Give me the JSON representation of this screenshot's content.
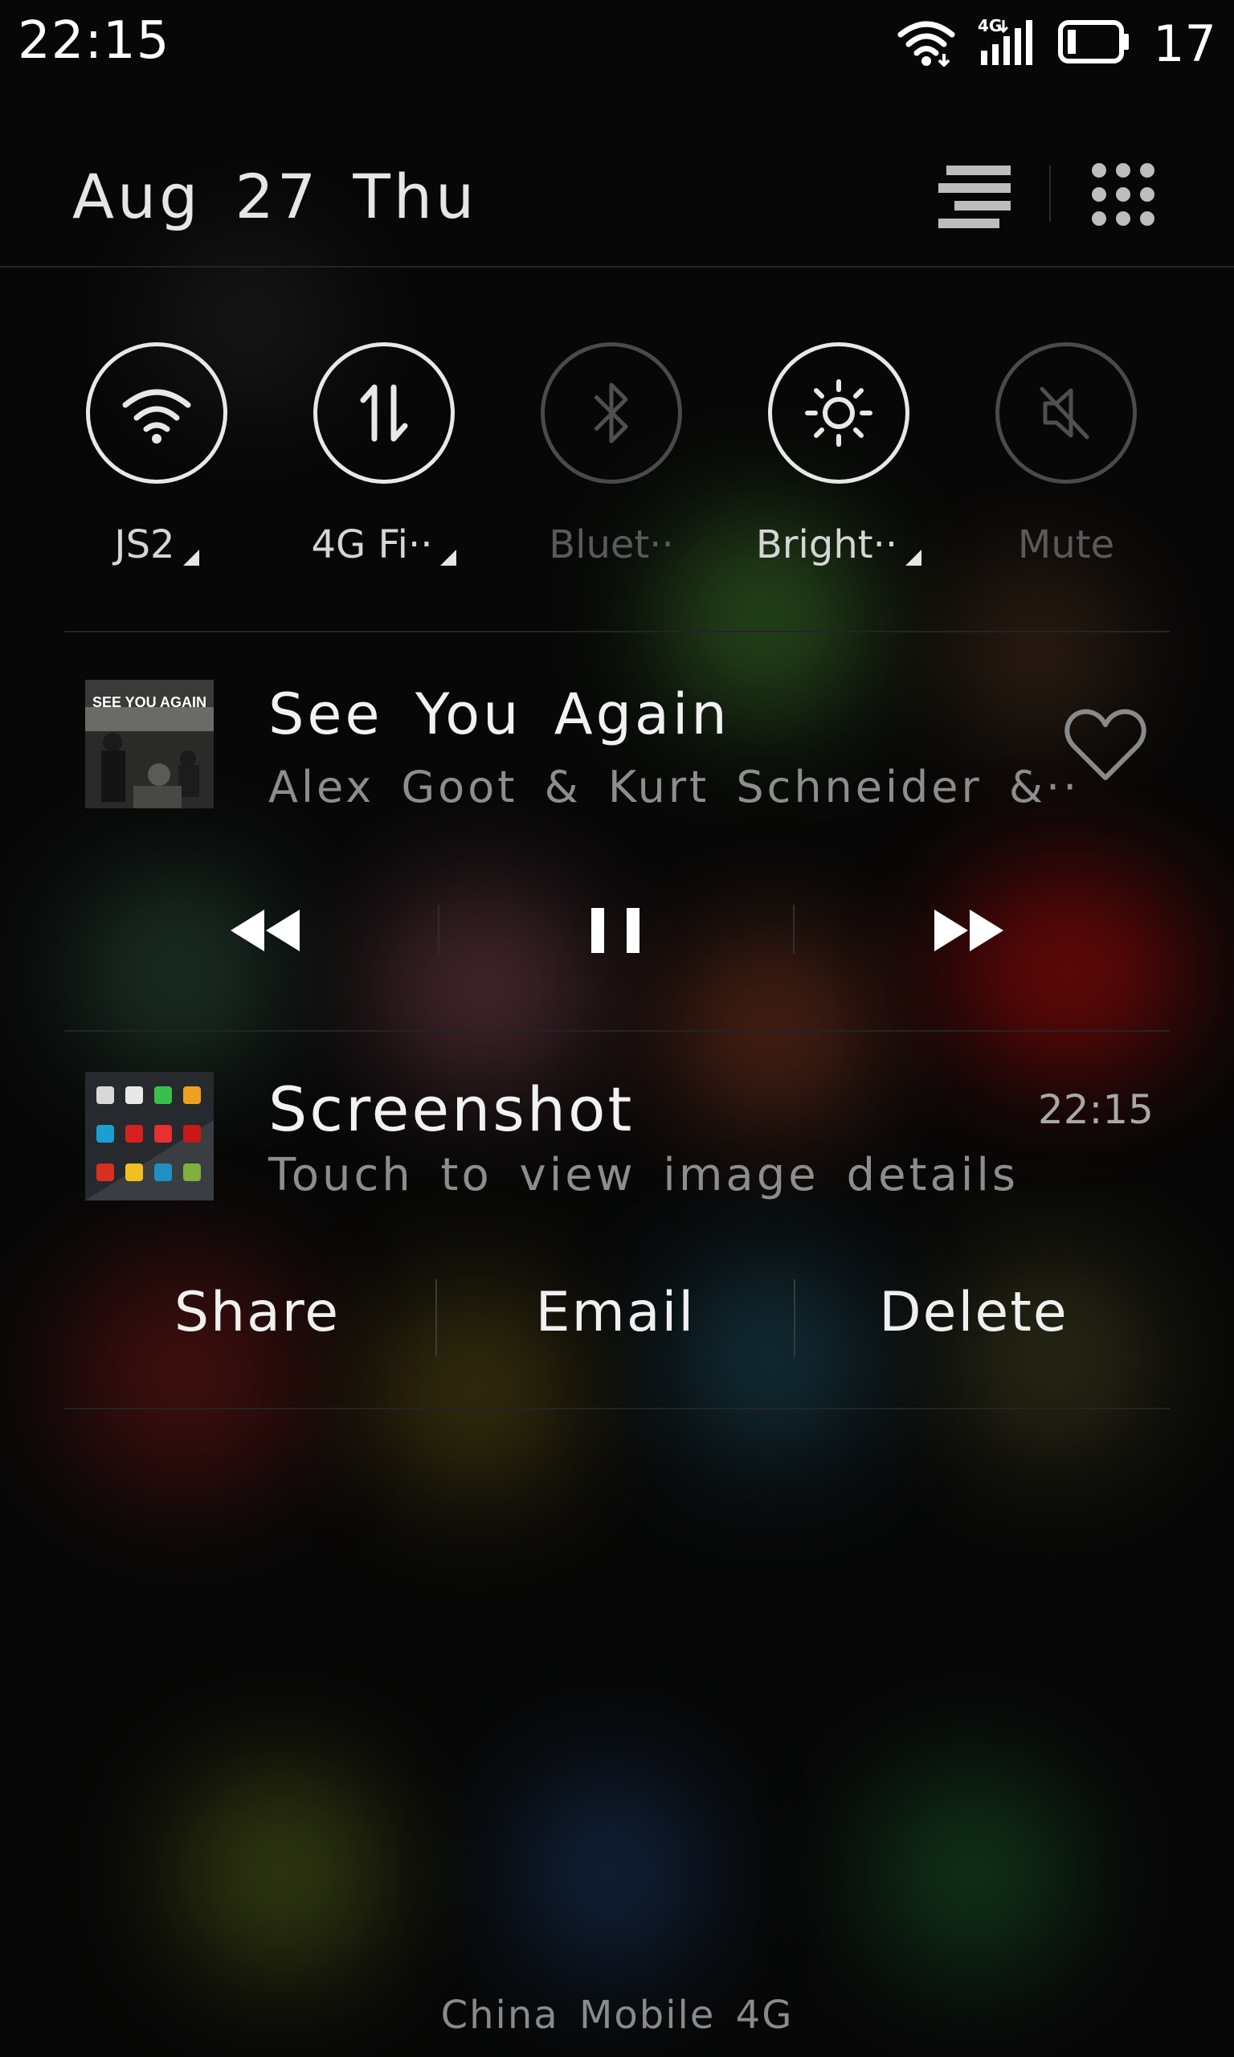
{
  "status_bar": {
    "time": "22:15",
    "network_type": "4G",
    "battery_level": "17",
    "icons": [
      "wifi-icon",
      "cellular-signal-icon",
      "battery-icon"
    ]
  },
  "header": {
    "date": "Aug 27 Thu",
    "buttons": [
      "notification-list-icon",
      "app-grid-icon"
    ]
  },
  "quick_toggles": [
    {
      "label": "JS2",
      "icon": "wifi-icon",
      "active": true,
      "has_menu": true
    },
    {
      "label": "4G Fi··",
      "icon": "mobile-data-icon",
      "active": true,
      "has_menu": true
    },
    {
      "label": "Bluet··",
      "icon": "bluetooth-icon",
      "active": false,
      "has_menu": false
    },
    {
      "label": "Bright··",
      "icon": "brightness-icon",
      "active": true,
      "has_menu": true
    },
    {
      "label": "Mute",
      "icon": "mute-icon",
      "active": false,
      "has_menu": false
    }
  ],
  "music": {
    "album_art_text": "SEE YOU AGAIN",
    "title": "See You Again",
    "artist": "Alex Goot & Kurt Schneider &··",
    "controls": [
      "previous-icon",
      "pause-icon",
      "next-icon"
    ],
    "favorite_icon": "heart-icon"
  },
  "screenshot_notification": {
    "title": "Screenshot",
    "time": "22:15",
    "description": "Touch to view image details",
    "actions": [
      "Share",
      "Email",
      "Delete"
    ]
  },
  "carrier": "China Mobile 4G"
}
